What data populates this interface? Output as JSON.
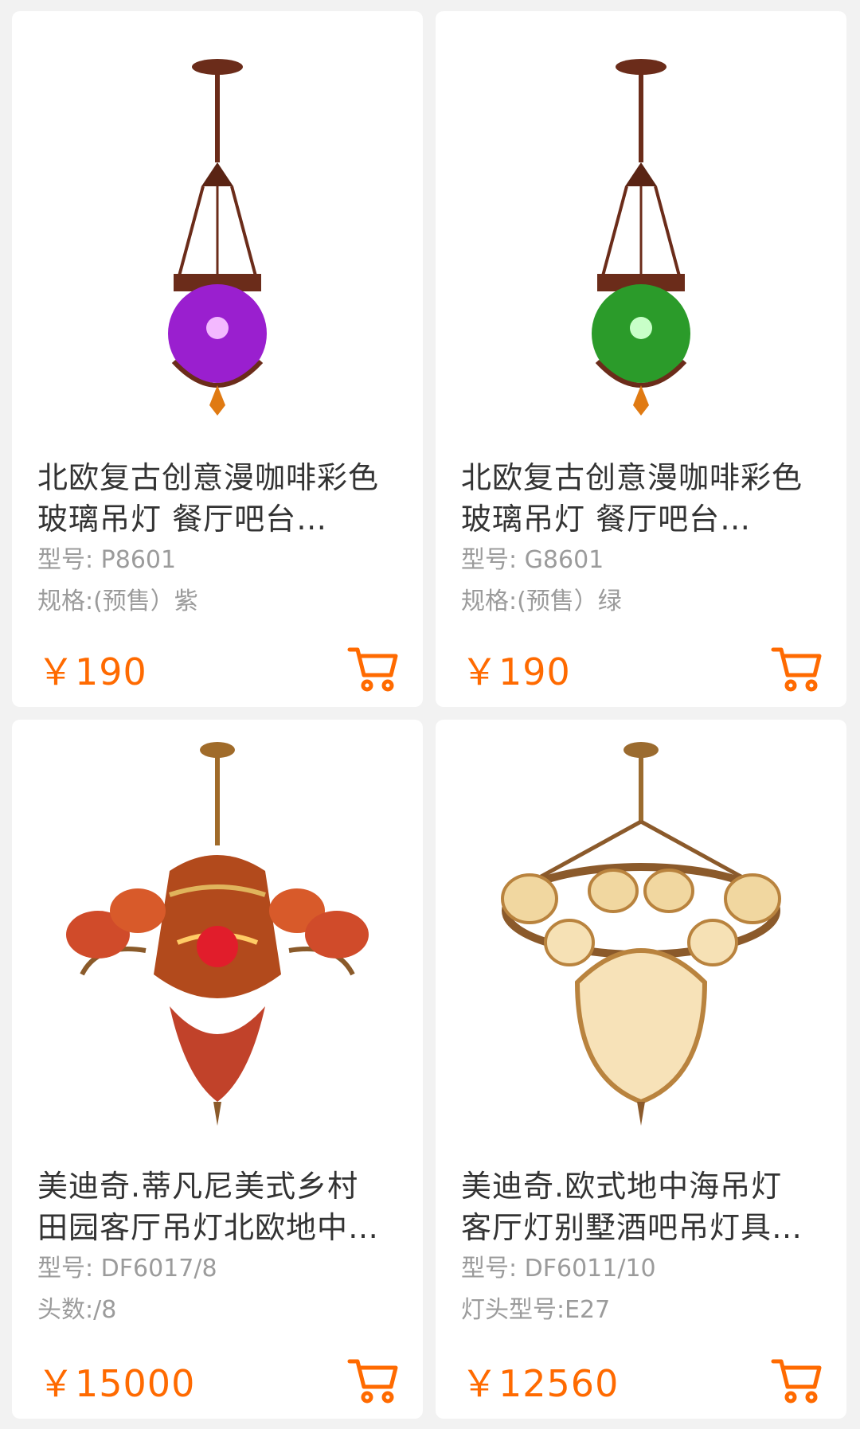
{
  "products": [
    {
      "title": "北欧复古创意漫咖啡彩色玻璃吊灯 餐厅吧台…",
      "model": "型号:  P8601",
      "spec": "规格:(预售）紫",
      "price": "￥190",
      "image": "purple-glass-pendant-lamp"
    },
    {
      "title": "北欧复古创意漫咖啡彩色玻璃吊灯 餐厅吧台…",
      "model": "型号:  G8601",
      "spec": "规格:(预售）绿",
      "price": "￥190",
      "image": "green-glass-pendant-lamp"
    },
    {
      "title": "美迪奇.蒂凡尼美式乡村田园客厅吊灯北欧地中…",
      "model": "型号:  DF6017/8",
      "spec": "头数:/8",
      "price": "￥15000",
      "image": "tiffany-chandelier"
    },
    {
      "title": "美迪奇.欧式地中海吊灯客厅灯别墅酒吧吊灯具…",
      "model": "型号:  DF6011/10",
      "spec": "灯头型号:E27",
      "price": "￥12560",
      "image": "mediterranean-chandelier"
    }
  ],
  "colors": {
    "price": "#ff6a00",
    "cart": "#ff6a00",
    "title": "#333333",
    "meta": "#9b9b9b",
    "background": "#f2f2f2"
  },
  "icons": {
    "cart": "shopping-cart-icon"
  }
}
